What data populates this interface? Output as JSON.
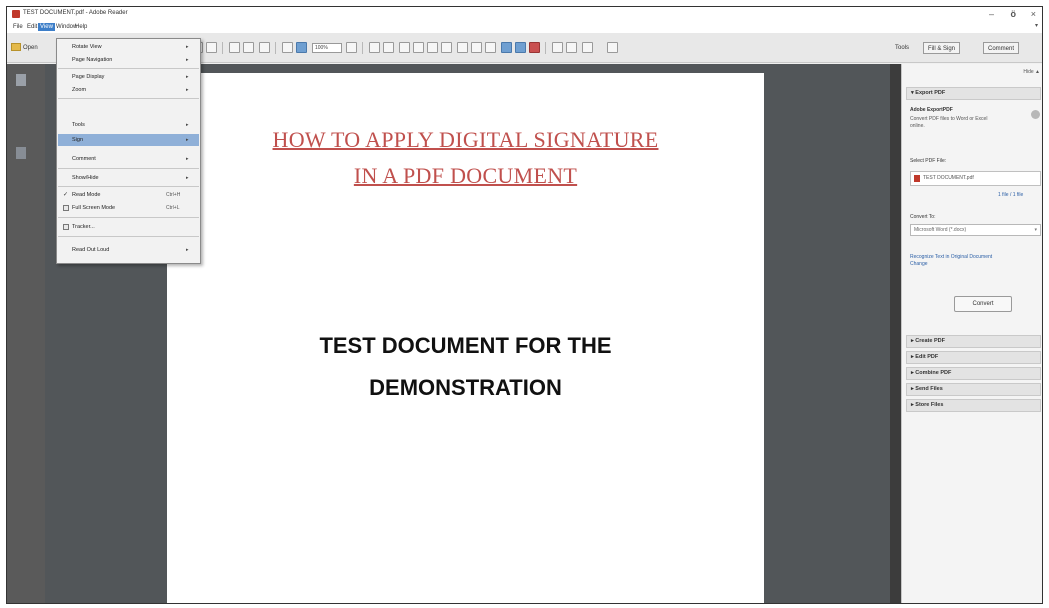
{
  "window": {
    "title": "TEST DOCUMENT.pdf - Adobe Reader",
    "minimize": "–",
    "maximize": "ö",
    "close": "×"
  },
  "menubar": {
    "items": [
      "File",
      "Edit",
      "View",
      "Window",
      "Help"
    ],
    "active": "View",
    "overflow": "▾"
  },
  "toolbar": {
    "open_label": "Open",
    "zoom": "100%",
    "tools": "Tools",
    "fill_sign": "Fill & Sign",
    "comment": "Comment"
  },
  "view_menu": {
    "items": [
      {
        "label": "Rotate View",
        "submenu": true
      },
      {
        "label": "Page Navigation",
        "submenu": true
      },
      {
        "label": "Page Display",
        "submenu": true
      },
      {
        "label": "Zoom",
        "submenu": true
      },
      {
        "label": "Tools",
        "submenu": true
      },
      {
        "label": "Sign",
        "submenu": true,
        "highlighted": true
      },
      {
        "label": "Comment",
        "submenu": true
      },
      {
        "label": "Show/Hide",
        "submenu": true
      },
      {
        "label": "Read Mode",
        "shortcut": "Ctrl+H",
        "check": "✓"
      },
      {
        "label": "Full Screen Mode",
        "shortcut": "Ctrl+L"
      },
      {
        "label": "Tracker..."
      },
      {
        "label": "Read Out Loud",
        "submenu": true
      }
    ]
  },
  "document": {
    "heading_line1": "HOW TO APPLY DIGITAL SIGNATURE",
    "heading_line2": "IN A PDF DOCUMENT",
    "title_line1": "TEST DOCUMENT FOR THE",
    "title_line2": "DEMONSTRATION",
    "heading_color": "#c0504d"
  },
  "tools_pane": {
    "hide": "Hide ▲",
    "export_pdf": "Export PDF",
    "service_name": "Adobe ExportPDF",
    "service_desc_1": "Convert PDF files to Word or Excel",
    "service_desc_2": "online.",
    "select_file_label": "Select PDF File:",
    "selected_file": "TEST DOCUMENT.pdf",
    "select_change": "1 file / 1 file",
    "convert_to_label": "Convert To:",
    "convert_to_value": "Microsoft Word (*.docx)",
    "recognize_1": "Recognize Text in Original Document",
    "recognize_2": "Change",
    "convert_button": "Convert",
    "sections": [
      "Create PDF",
      "Edit PDF",
      "Combine PDF",
      "Send Files",
      "Store Files"
    ]
  }
}
